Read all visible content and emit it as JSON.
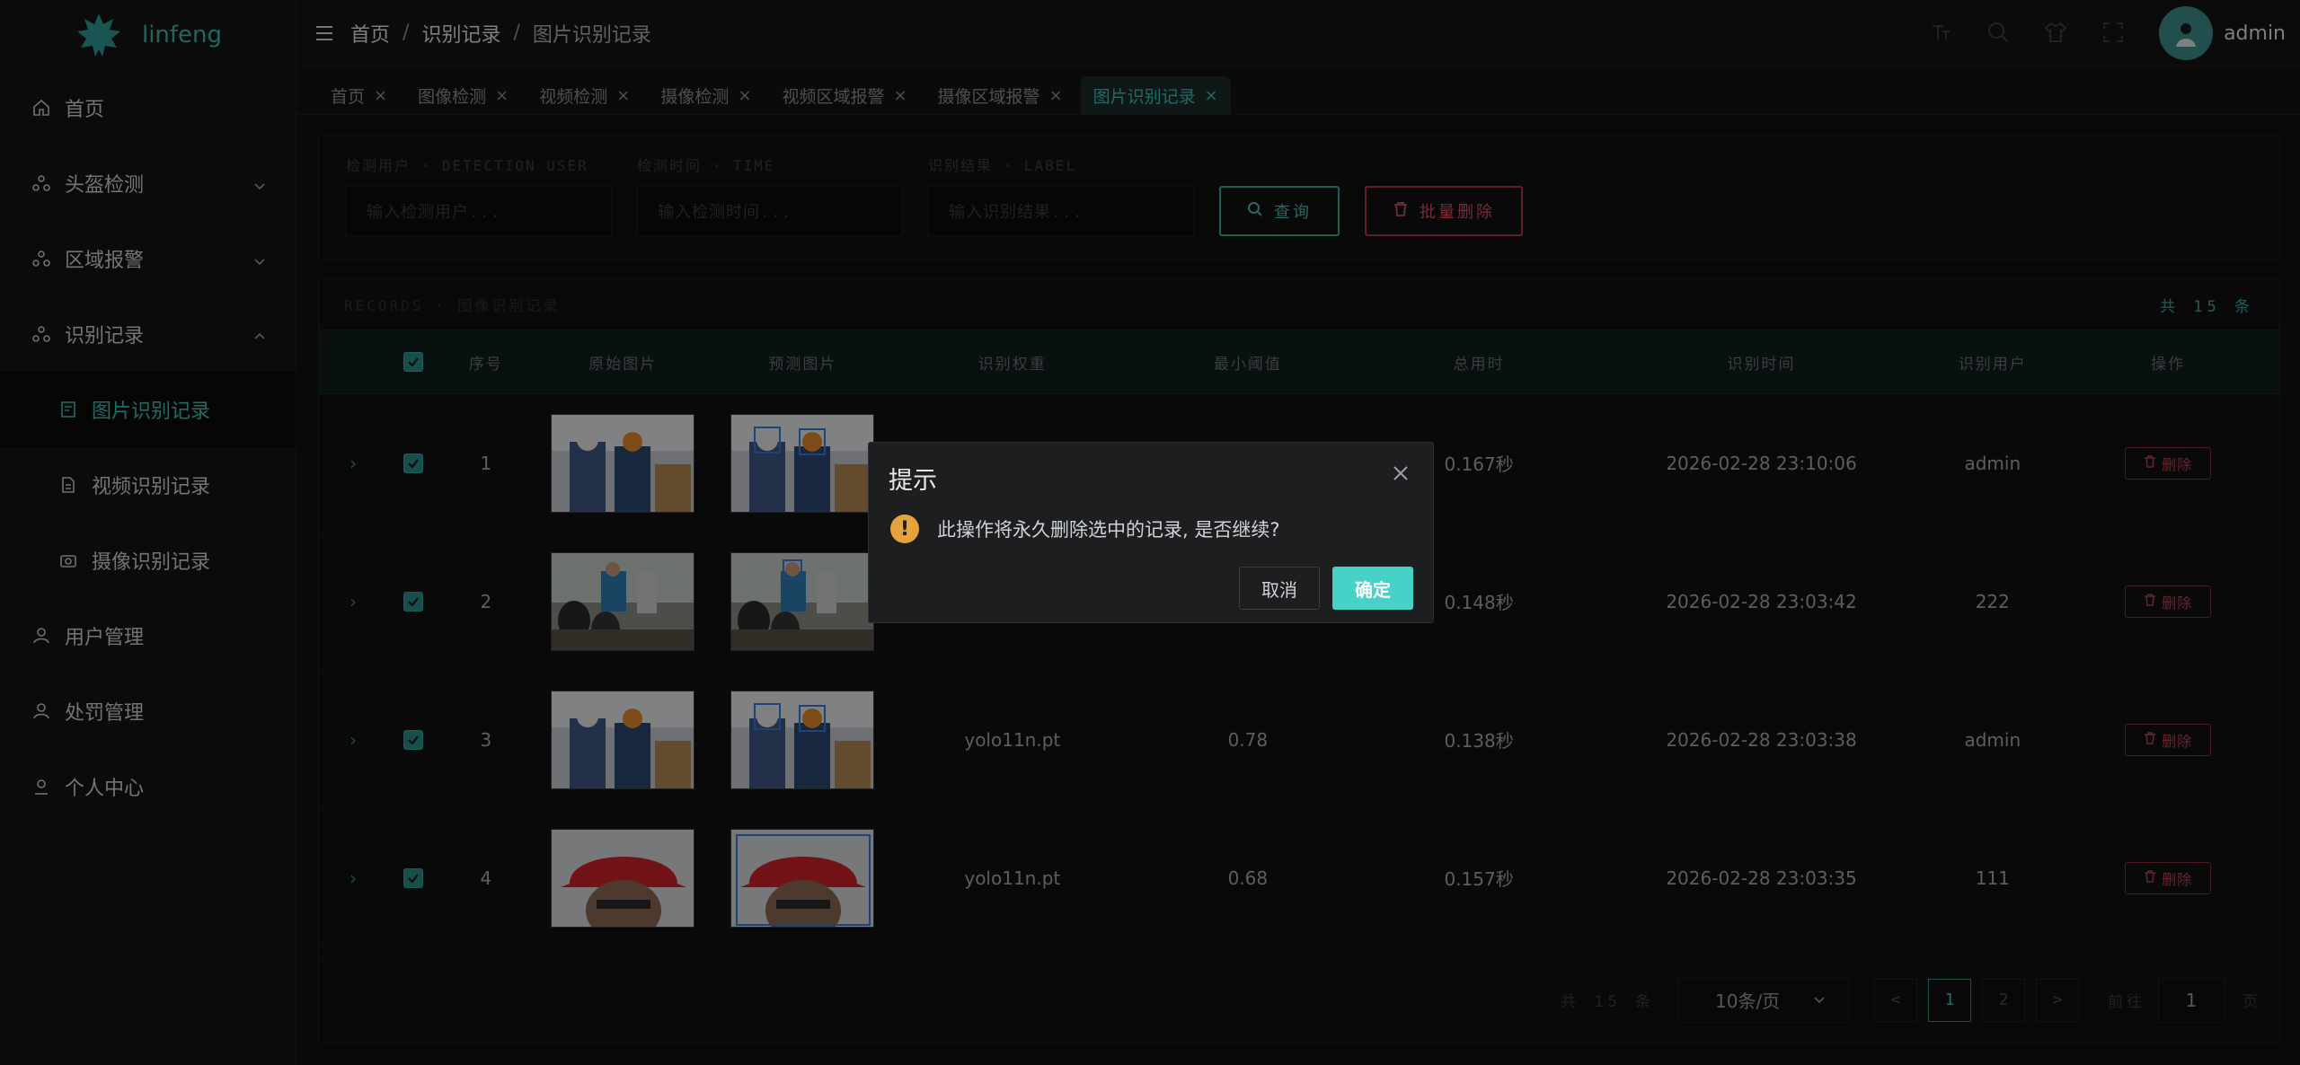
{
  "app": {
    "brand": "linfeng"
  },
  "sidebar": {
    "items": [
      {
        "label": "首页"
      },
      {
        "label": "头盔检测"
      },
      {
        "label": "区域报警"
      },
      {
        "label": "识别记录"
      },
      {
        "label": "图片识别记录"
      },
      {
        "label": "视频识别记录"
      },
      {
        "label": "摄像识别记录"
      },
      {
        "label": "用户管理"
      },
      {
        "label": "处罚管理"
      },
      {
        "label": "个人中心"
      }
    ]
  },
  "header": {
    "breadcrumb": [
      "首页",
      "识别记录",
      "图片识别记录"
    ],
    "separator": "/",
    "user": "admin"
  },
  "tabs": [
    "首页",
    "图像检测",
    "视频检测",
    "摄像检测",
    "视频区域报警",
    "摄像区域报警",
    "图片识别记录"
  ],
  "search": {
    "user_label": "检测用户 · DETECTION USER",
    "user_placeholder": "输入检测用户...",
    "time_label": "检测时间 · TIME",
    "time_placeholder": "输入检测时间...",
    "result_label": "识别结果 · LABEL",
    "result_placeholder": "输入识别结果...",
    "query_button": "查询",
    "bulk_delete_button": "批量删除"
  },
  "table": {
    "section_title": "RECORDS · 图像识别记录",
    "count_text": "共 15 条",
    "columns": [
      "序号",
      "原始图片",
      "预测图片",
      "识别权重",
      "最小阈值",
      "总用时",
      "识别时间",
      "识别用户",
      "操作"
    ],
    "delete_label": "删除",
    "rows": [
      {
        "no": "1",
        "weight": "",
        "threshold": "",
        "duration": "0.167秒",
        "time": "2026-02-28 23:10:06",
        "user": "admin"
      },
      {
        "no": "2",
        "weight": "",
        "threshold": "",
        "duration": "0.148秒",
        "time": "2026-02-28 23:03:42",
        "user": "222"
      },
      {
        "no": "3",
        "weight": "yolo11n.pt",
        "threshold": "0.78",
        "duration": "0.138秒",
        "time": "2026-02-28 23:03:38",
        "user": "admin"
      },
      {
        "no": "4",
        "weight": "yolo11n.pt",
        "threshold": "0.68",
        "duration": "0.157秒",
        "time": "2026-02-28 23:03:35",
        "user": "111"
      }
    ]
  },
  "pagination": {
    "total_text": "共 15 条",
    "page_size": "10条/页",
    "prev": "<",
    "pages": [
      "1",
      "2"
    ],
    "next": ">",
    "goto_label": "前往",
    "goto_value": "1",
    "unit": "页"
  },
  "dialog": {
    "title": "提示",
    "message": "此操作将永久删除选中的记录, 是否继续?",
    "cancel": "取消",
    "confirm": "确定"
  },
  "colors": {
    "accent": "#3fc1b8",
    "danger": "#d2535f",
    "warning": "#e6a23c",
    "confirm": "#48d1c6"
  }
}
